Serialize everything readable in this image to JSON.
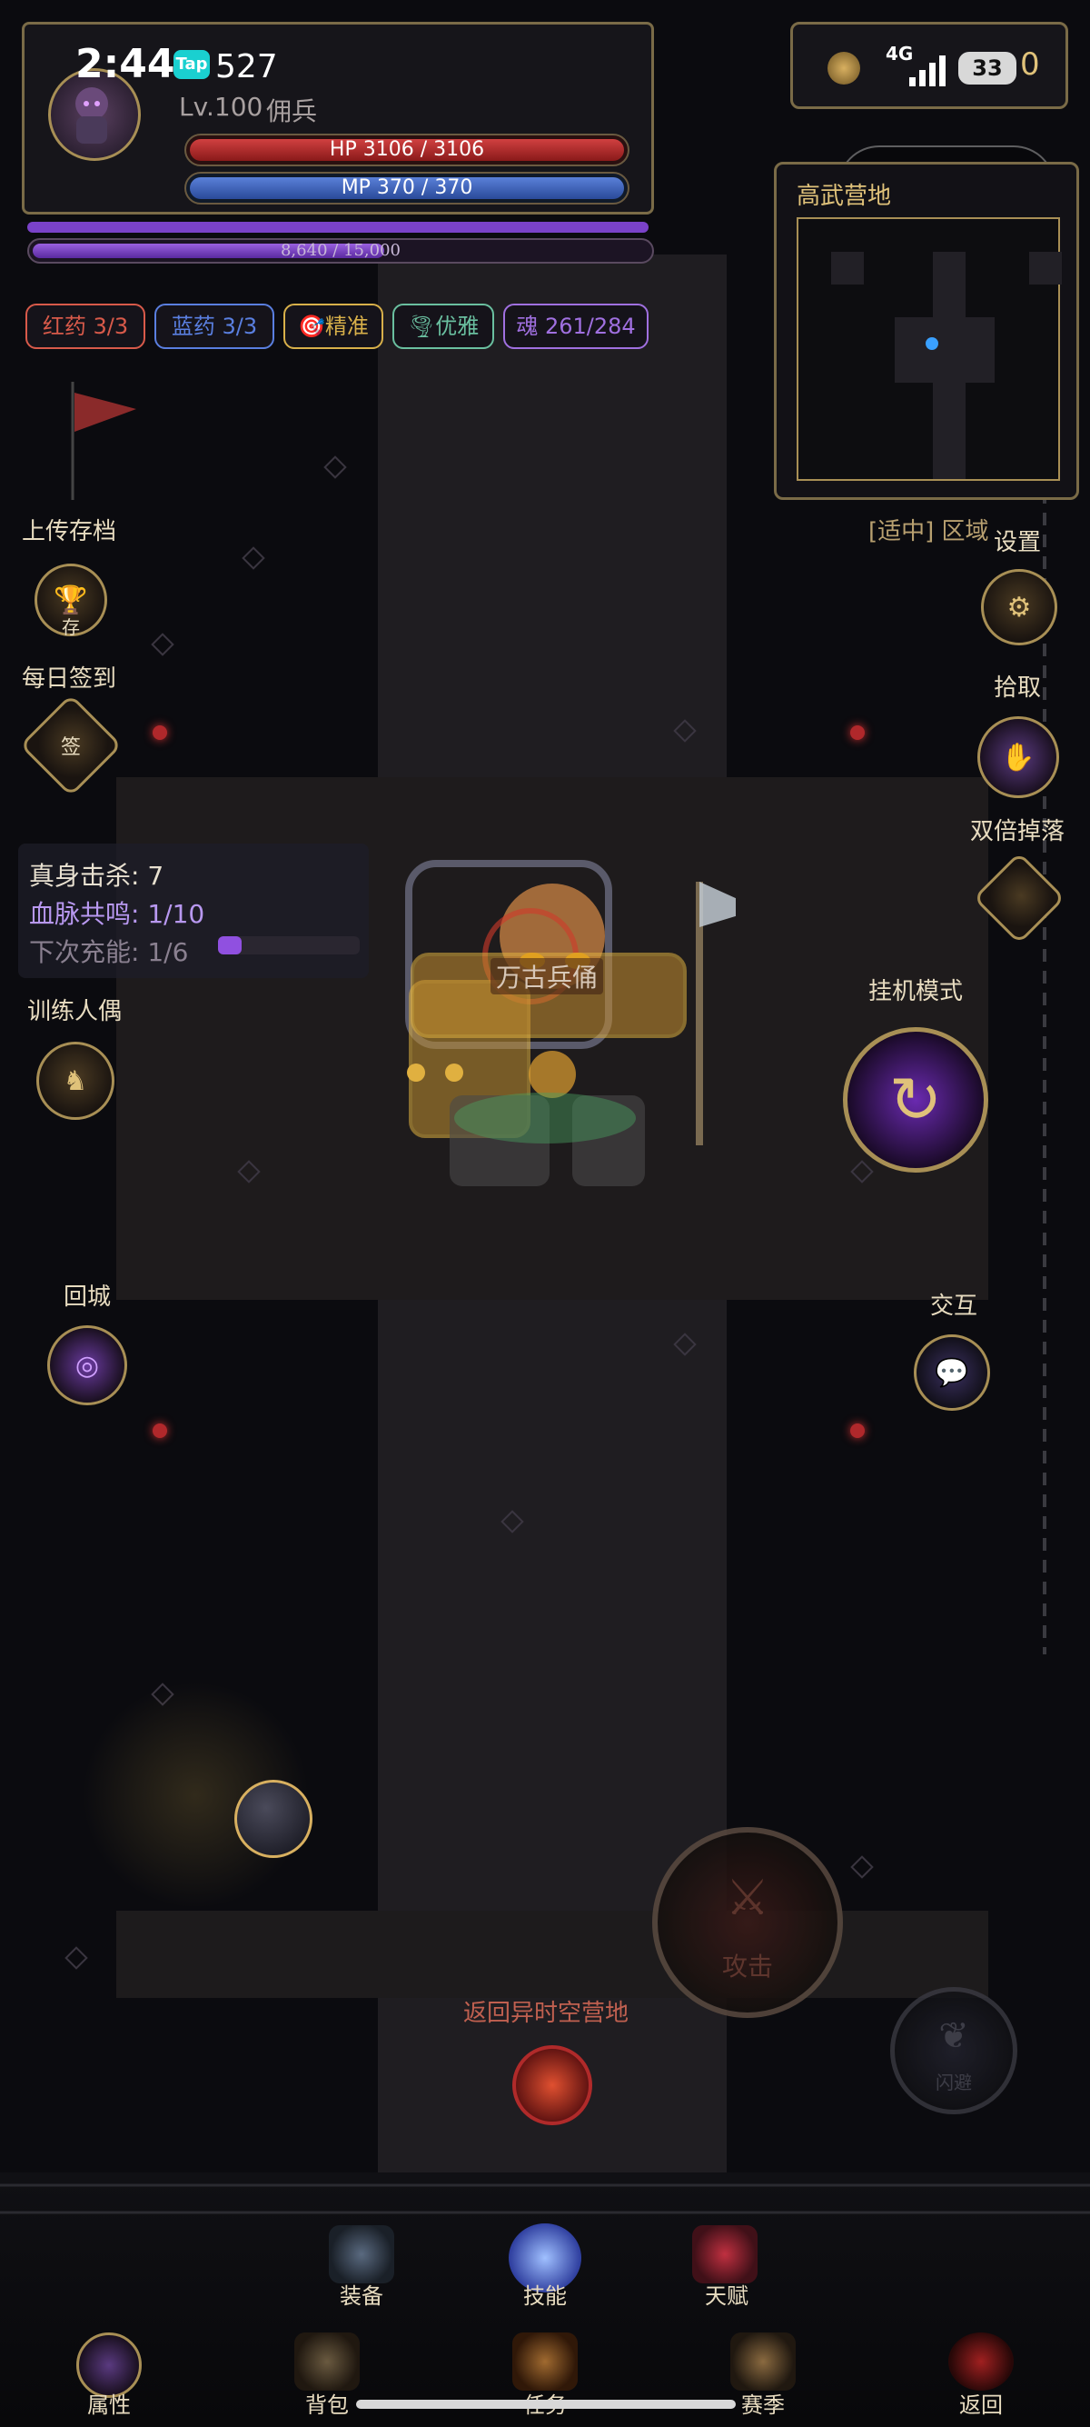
{
  "status_bar": {
    "time": "2:44",
    "app_badge": "Tap",
    "network": "4G",
    "battery": "33"
  },
  "player": {
    "id_fragment": "527",
    "level_text": "Lv.100",
    "class_name": "佣兵",
    "hp_text": "HP 3106 / 3106",
    "mp_text": "MP 370 / 370",
    "exp_text": "8,640 / 15,000",
    "hp_fill": 1.0,
    "mp_fill": 1.0,
    "exp_fill": 0.576
  },
  "gold": "0",
  "pills": [
    {
      "label": "红药 3/3",
      "color": "#d85a4a"
    },
    {
      "label": "蓝药 3/3",
      "color": "#5a7fe0"
    },
    {
      "label": "🎯精准",
      "color": "#d8b04a"
    },
    {
      "label": "🌪优雅",
      "color": "#6ac0a0"
    },
    {
      "label": "魂 261/284",
      "color": "#a070e0"
    }
  ],
  "minimap": {
    "title": "高武营地",
    "region": "[适中] 区域"
  },
  "left_menu": {
    "upload": "上传存档",
    "upload_glyph": "存",
    "daily": "每日签到",
    "daily_glyph": "签",
    "training": "训练人偶",
    "return_city": "回城"
  },
  "right_menu": {
    "settings": "设置",
    "pickup": "拾取",
    "double_drop": "双倍掉落",
    "auto_mode": "挂机模式",
    "interact": "交互"
  },
  "combat_info": {
    "kills": "真身击杀: 7",
    "resonance": "血脉共鸣: 1/10",
    "next_charge": "下次充能: 1/6",
    "charge_fill": 0.167
  },
  "boss": {
    "name": "万古兵俑"
  },
  "actions": {
    "attack": "攻击",
    "dodge": "闪避",
    "portal": "返回异时空营地"
  },
  "bottom_tabs_upper": [
    "装备",
    "技能",
    "天赋"
  ],
  "bottom_tabs_lower": [
    "属性",
    "背包",
    "任务",
    "赛季",
    "返回"
  ],
  "colors": {
    "gold_border": "#a88f55",
    "hp": "#b52a2a",
    "mp": "#3a5fb0",
    "exp": "#7a42c8"
  }
}
